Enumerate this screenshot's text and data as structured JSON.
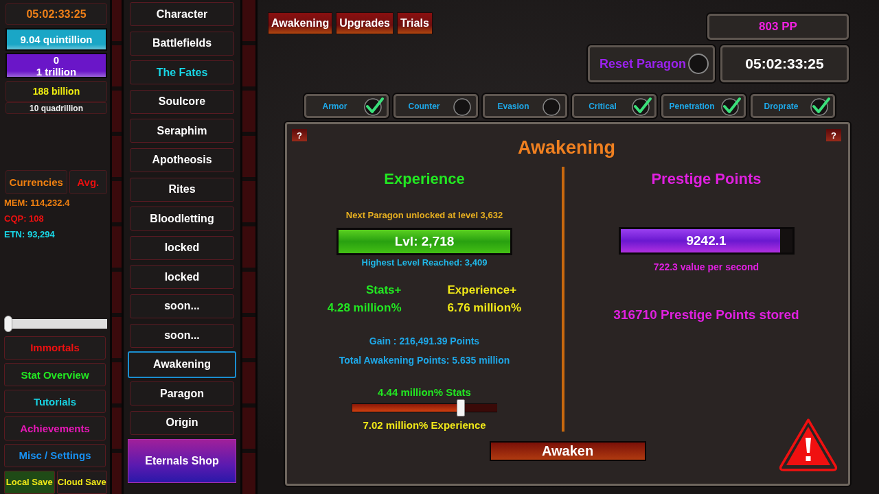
{
  "sidebar": {
    "timer": "05:02:33:25",
    "resources": [
      {
        "lines": [
          "9.04 quintillion"
        ],
        "color": "#1aa6c6"
      },
      {
        "lines": [
          "0",
          "1 trillion"
        ],
        "color": "#6a16c8"
      }
    ],
    "balance": "188 billion",
    "cap": "10 quadrillion",
    "currency_tabs": [
      {
        "label": "Currencies",
        "color": "#f08010"
      },
      {
        "label": "Avg.",
        "color": "#e81010"
      }
    ],
    "currencies": [
      {
        "text": "MEM: 114,232.4",
        "color": "#f08010"
      },
      {
        "text": "CQP: 108",
        "color": "#ee1010"
      },
      {
        "text": "ETN: 93,294",
        "color": "#18d8e8"
      }
    ],
    "volume_slider": {
      "level": 0
    },
    "menu_buttons": [
      {
        "label": "Immortals",
        "color": "#f01010"
      },
      {
        "label": "Stat Overview",
        "color": "#22e822"
      },
      {
        "label": "Tutorials",
        "color": "#18d0e0"
      },
      {
        "label": "Achievements",
        "color": "#e818b8"
      },
      {
        "label": "Misc / Settings",
        "color": "#1890f0"
      }
    ],
    "save_buttons": [
      {
        "label": "Local Save",
        "selected": true
      },
      {
        "label": "Cloud Save",
        "selected": false
      }
    ]
  },
  "nav": [
    {
      "label": "Character",
      "selected": false,
      "color": "#ffffff"
    },
    {
      "label": "Battlefields",
      "selected": false,
      "color": "#ffffff"
    },
    {
      "label": "The Fates",
      "selected": false,
      "color": "#18d8e8"
    },
    {
      "label": "Soulcore",
      "selected": false,
      "color": "#ffffff"
    },
    {
      "label": "Seraphim",
      "selected": false,
      "color": "#ffffff"
    },
    {
      "label": "Apotheosis",
      "selected": false,
      "color": "#ffffff"
    },
    {
      "label": "Rites",
      "selected": false,
      "color": "#ffffff"
    },
    {
      "label": "Bloodletting",
      "selected": false,
      "color": "#ffffff"
    },
    {
      "label": "locked",
      "selected": false,
      "color": "#ffffff"
    },
    {
      "label": "locked",
      "selected": false,
      "color": "#ffffff"
    },
    {
      "label": "soon...",
      "selected": false,
      "color": "#ffffff"
    },
    {
      "label": "soon...",
      "selected": false,
      "color": "#ffffff"
    },
    {
      "label": "Awakening",
      "selected": true,
      "color": "#ffffff"
    },
    {
      "label": "Paragon",
      "selected": false,
      "color": "#ffffff"
    },
    {
      "label": "Origin",
      "selected": false,
      "color": "#ffffff"
    }
  ],
  "shop_button": "Eternals Shop",
  "tabs": [
    "Awakening",
    "Upgrades",
    "Trials"
  ],
  "points": "803 PP",
  "reset": {
    "label": "Reset Paragon",
    "on": false
  },
  "timer": "05:02:33:25",
  "toggles": [
    {
      "label": "Armor",
      "checked": true
    },
    {
      "label": "Counter",
      "checked": false
    },
    {
      "label": "Evasion",
      "checked": false
    },
    {
      "label": "Critical",
      "checked": true
    },
    {
      "label": "Penetration",
      "checked": true
    },
    {
      "label": "Droprate",
      "checked": true
    }
  ],
  "panel": {
    "title": "Awakening",
    "help_buttons": [
      "?",
      "?"
    ],
    "experience": {
      "title": "Experience",
      "next_unlock": "Next Paragon unlocked at level 3,632",
      "level_bar": {
        "text": "Lvl: 2,718",
        "level": 1
      },
      "highest": "Highest Level Reached: 3,409",
      "bonuses": [
        {
          "label": "Stats+",
          "value": "4.28 million%",
          "color": "#22e822"
        },
        {
          "label": "Experience+",
          "value": "6.76 million%",
          "color": "#f0e818"
        }
      ],
      "gain": "Gain : 216,491.39 Points",
      "total": "Total Awakening Points: 5.635 million",
      "split_slider": {
        "top": "4.44 million% Stats",
        "bottom": "7.02 million% Experience",
        "level": 0.75
      }
    },
    "prestige": {
      "title": "Prestige Points",
      "bar": {
        "text": "9242.1",
        "level": 0.93
      },
      "rate": "722.3 value per second",
      "stored": "316710 Prestige Points stored"
    },
    "action_button": "Awaken"
  }
}
